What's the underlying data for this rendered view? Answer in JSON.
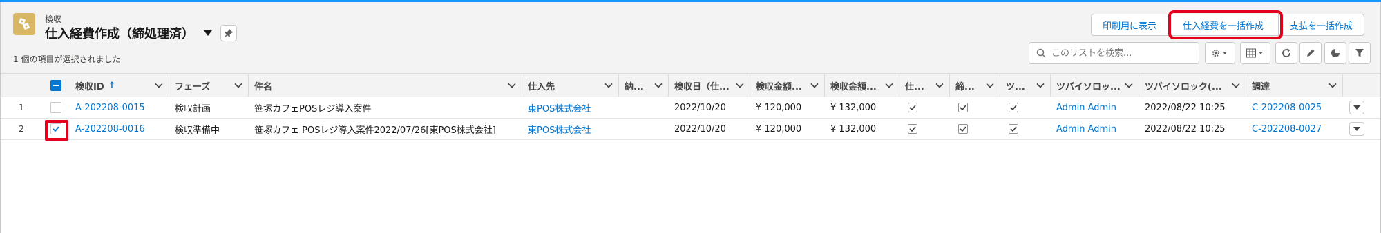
{
  "header": {
    "object_label": "検収",
    "title": "仕入経費作成（締処理済）",
    "status": "1 個の項目が選択されました"
  },
  "actions": {
    "print_view": "印刷用に表示",
    "bulk_create_expense": "仕入経費を一括作成",
    "bulk_create_payment": "支払を一括作成"
  },
  "search": {
    "placeholder": "このリストを検索..."
  },
  "table": {
    "columns": [
      "検収ID",
      "フェーズ",
      "件名",
      "仕入先",
      "納...",
      "検収日（仕...",
      "検収金額...",
      "検収金額...",
      "仕...",
      "締...",
      "ツ...",
      "ツバイソロッ...",
      "ツバイソロック(...",
      "調達"
    ],
    "sort_indicator": "↑",
    "rows": [
      {
        "num": "1",
        "selected": false,
        "id": "A-202208-0015",
        "phase": "検収計画",
        "subject": "笹塚カフェPOSレジ導入案件",
        "vendor": "東POS株式会社",
        "delivery": "",
        "date": "2022/10/20",
        "amount1": "¥ 120,000",
        "amount2": "¥ 132,000",
        "check1": true,
        "check2": true,
        "check3": true,
        "user": "Admin Admin",
        "datetime": "2022/08/22 10:25",
        "procurement": "C-202208-0025"
      },
      {
        "num": "2",
        "selected": true,
        "id": "A-202208-0016",
        "phase": "検収準備中",
        "subject": "笹塚カフェ POSレジ導入案件2022/07/26[東POS株式会社]",
        "vendor": "東POS株式会社",
        "delivery": "",
        "date": "2022/10/20",
        "amount1": "¥ 120,000",
        "amount2": "¥ 132,000",
        "check1": true,
        "check2": true,
        "check3": true,
        "user": "Admin Admin",
        "datetime": "2022/08/22 10:25",
        "procurement": "C-202208-0027"
      }
    ]
  },
  "colors": {
    "accent": "#0176d3",
    "highlight": "#e5001c",
    "app_icon": "#d8b764"
  }
}
